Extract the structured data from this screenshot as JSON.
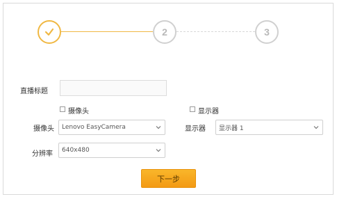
{
  "steps": [
    {
      "label": "",
      "state": "done",
      "icon": "check-icon"
    },
    {
      "label": "2",
      "state": "pending"
    },
    {
      "label": "3",
      "state": "pending"
    }
  ],
  "form": {
    "title_label": "直播标题",
    "title_value": "",
    "camera_checkbox_label": "摄像头",
    "display_checkbox_label": "显示器",
    "camera_label": "摄像头",
    "camera_value": "Lenovo EasyCamera",
    "display_label": "显示器",
    "display_value": "显示器 1",
    "resolution_label": "分辨率",
    "resolution_value": "640x480"
  },
  "next_button_label": "下一步",
  "colors": {
    "accent": "#f0b843",
    "button": "#f5a81e",
    "inactive": "#d0d0d0"
  }
}
